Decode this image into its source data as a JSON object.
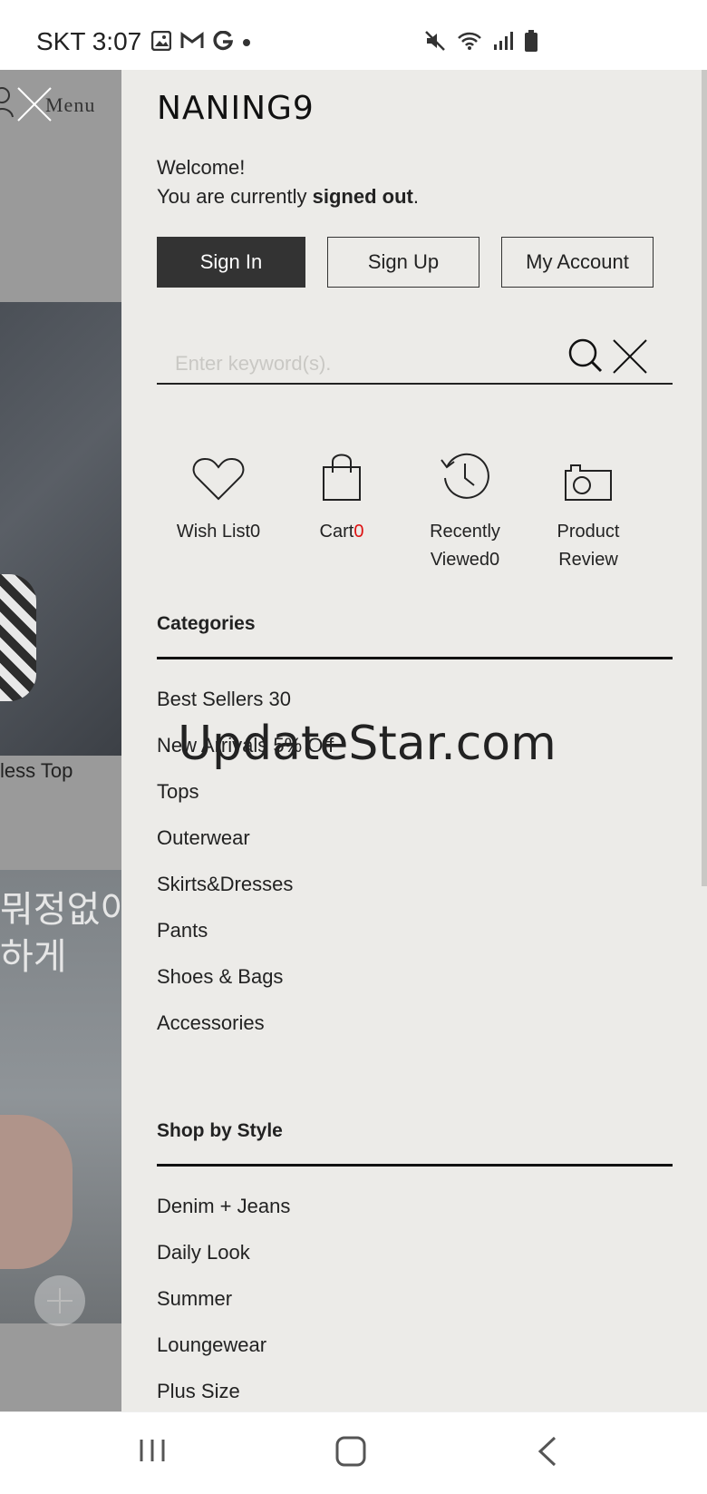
{
  "status_bar": {
    "carrier_time": "SKT 3:07",
    "left_icons": [
      "gallery-icon",
      "gmail-icon",
      "google-icon",
      "dot-icon"
    ],
    "right_icons": [
      "mute-icon",
      "wifi-icon",
      "signal-icon",
      "battery-icon"
    ]
  },
  "background_page": {
    "menu_label": "Menu",
    "product_caption": "less Top",
    "banner_text": "뭐정없이\n하게"
  },
  "drawer": {
    "logo": "NANING9",
    "welcome_line1": "Welcome!",
    "welcome_line2_prefix": "You are currently ",
    "welcome_line2_bold": "signed out",
    "welcome_line2_suffix": ".",
    "buttons": {
      "sign_in": "Sign In",
      "sign_up": "Sign Up",
      "my_account": "My Account"
    },
    "search": {
      "placeholder": "Enter keyword(s).",
      "value": ""
    },
    "shortcuts": [
      {
        "label": "Wish List",
        "count": "0",
        "icon": "heart-icon"
      },
      {
        "label": "Cart",
        "count": "0",
        "icon": "shopping-bag-icon"
      },
      {
        "label_line1": "Recently",
        "label_line2": "Viewed",
        "count": "0",
        "icon": "history-clock-icon"
      },
      {
        "label_line1": "Product",
        "label_line2": "Review",
        "icon": "camera-icon"
      }
    ],
    "categories_title": "Categories",
    "categories": [
      "Best Sellers 30",
      "New Arrivals 5% Off",
      "Tops",
      "Outerwear",
      "Skirts&Dresses",
      "Pants",
      "Shoes & Bags",
      "Accessories"
    ],
    "style_title": "Shop by Style",
    "styles": [
      "Denim + Jeans",
      "Daily Look",
      "Summer",
      "Loungewear",
      "Plus Size"
    ]
  },
  "watermark": "UpdateStar.com",
  "colors": {
    "drawer_bg": "#ecebe8",
    "sign_in_bg": "#333333",
    "cart_count": "#dd1111",
    "overlay": "#9a9a9a"
  }
}
